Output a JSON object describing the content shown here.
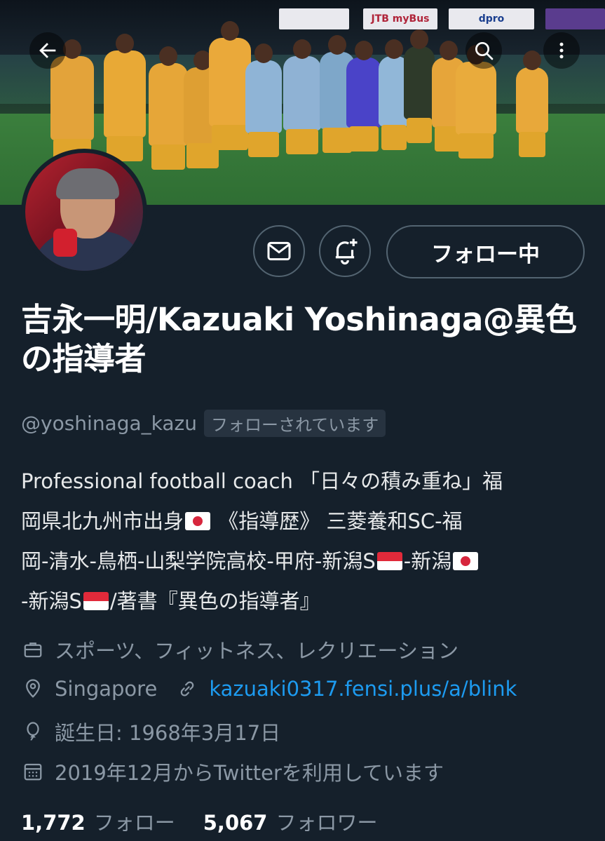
{
  "nav": {
    "back_icon": "arrow-left-icon",
    "search_icon": "search-icon",
    "more_icon": "more-vertical-icon"
  },
  "banner": {
    "ad_boards": [
      "JTB myBus",
      "dpro"
    ]
  },
  "actions": {
    "message_icon": "mail-icon",
    "notify_icon": "bell-plus-icon",
    "follow_label": "フォロー中"
  },
  "profile": {
    "name": "吉永一明/Kazuaki Yoshinaga@異色の指導者",
    "handle": "@yoshinaga_kazu",
    "follows_you": "フォローされています",
    "bio": {
      "l1": "Professional football coach 「日々の積み重ね」福",
      "l2a": "岡県北九州市出身",
      "l2b": " 《指導歴》 三菱養和SC-福",
      "l3a": "岡-清水-鳥栖-山梨学院高校-甲府-新潟S",
      "l3b": "-新潟",
      "l4a": "-新潟S",
      "l4b": "/著書『異色の指導者』"
    },
    "category": "スポーツ、フィットネス、レクリエーション",
    "location": "Singapore",
    "website": "kazuaki0317.fensi.plus/a/blink",
    "birthday": "誕生日: 1968年3月17日",
    "joined": "2019年12月からTwitterを利用しています"
  },
  "stats": {
    "following_count": "1,772",
    "following_label": "フォロー",
    "followers_count": "5,067",
    "followers_label": "フォロワー"
  },
  "colors": {
    "background": "#15202b",
    "secondary_text": "#8b98a5",
    "link": "#1d9bf0",
    "border": "#536471"
  }
}
